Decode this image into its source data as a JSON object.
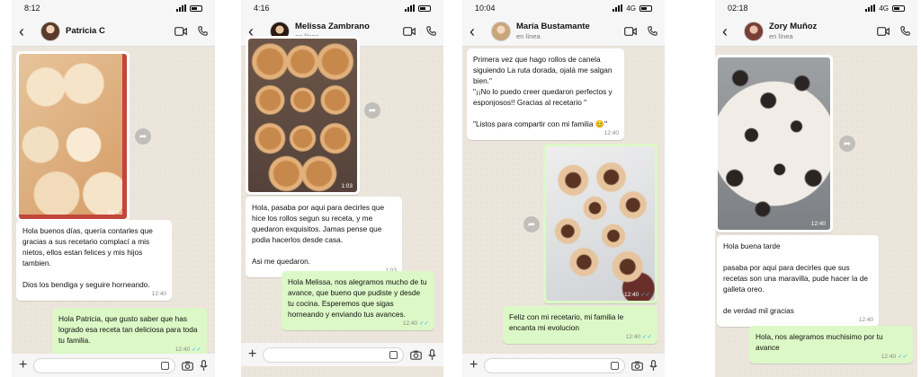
{
  "colors": {
    "outgoing_bubble": "#dcf8c6",
    "incoming_bubble": "#ffffff",
    "chat_bg": "#ece5dc",
    "read_ticks": "#34b7f1"
  },
  "icons": [
    "back-arrow-icon",
    "video-call-icon",
    "phone-icon",
    "forward-icon",
    "plus-icon",
    "sticker-icon",
    "camera-icon",
    "mic-icon"
  ],
  "phones": [
    {
      "time": "8:12",
      "contact": "Patricia C",
      "subtitle": "",
      "image": {
        "time": "12:40",
        "desc": "cinnamon rolls in red dish"
      },
      "messages": [
        {
          "text": "Hola buenos días, quería contarles que gracias a sus recetario complací a mis nietos, ellos estan felices y mis hijos tambien.\n\nDios los bendiga y seguire horneando.",
          "time": "12:40"
        },
        {
          "text": "Hola Patricia, que gusto saber que has logrado esa receta tan deliciosa para toda tu familia.",
          "time": "12:40"
        }
      ]
    },
    {
      "time": "4:16",
      "contact": "Melissa Zambrano",
      "subtitle": "en línea",
      "image": {
        "time": "1:03",
        "desc": "cinnamon rolls on baking paper"
      },
      "messages": [
        {
          "text": "Hola, pasaba por aqui para decirles que hice los rollos segun su receta, y me quedaron exquisitos. Jamas pense que podia hacerlos desde casa.\n\nAsi me quedaron.",
          "time": "1:03"
        },
        {
          "text": "Hola Melissa, nos alegramos mucho de tu avance, que bueno que pudiste y desde tu cocina. Esperemos que sigas horneando y enviando tus avances.",
          "time": "12:40"
        }
      ]
    },
    {
      "time": "10:04",
      "contact": "María Bustamante",
      "subtitle": "en línea",
      "network": "4G",
      "image": {
        "time": "12:40",
        "desc": "cinnamon rolls on marble"
      },
      "messages": [
        {
          "text": "Primera vez que hago rollos de canela siguiendo La ruta dorada, ojalá me salgan bien.\"\n\"¡¡No lo puedo creer quedaron perfectos y esponjosos!! Gracias al recetario \"\n\n\"Listos para compartir con mi familia 😊\"",
          "time": "12:40"
        },
        {
          "text": "Feliz con mi recetario, mi familia le encanta mi evolucion",
          "time": "12:40"
        }
      ]
    },
    {
      "time": "02:18",
      "contact": "Zory Muñoz",
      "subtitle": "en línea",
      "network": "4G",
      "image": {
        "time": "12:40",
        "desc": "oreo cinnamon rolls in tray"
      },
      "messages": [
        {
          "text": "Hola buena tarde\n\npasaba por aqui para decirles que sus recetas son una maravilla, pude hacer la de galleta oreo.\n\nde verdad mil gracias",
          "time": "12:40"
        },
        {
          "text": "Hola, nos alegramos muchisimo por tu avance",
          "time": "12:40"
        }
      ]
    }
  ]
}
